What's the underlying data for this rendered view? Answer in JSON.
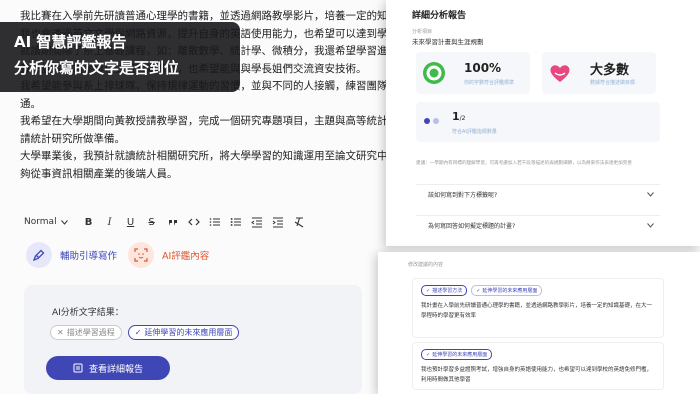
{
  "overlay": {
    "line1": "AI 智慧評鑑報告",
    "line2": "分析你寫的文字是否到位"
  },
  "doc": {
    "lines": [
      "我比賽在入學前先研讀普通心理學的書籍，並透過網路教學影片，培養一定的知識基礎",
      "我也會透過英文文學與網路資源，提升自身的英語使用能力，也希望可以達到學校的英語免修門檻",
      "就讀期間除了系上基礎課程，如：離散數學、統計學、微積分，我還希望學習進階演",
      "算法課程，為參與程式競賽做準備，也希望能與與學長姐們交流資安技術。",
      "我希望能參與系上排球隊，保持規律運動的習慣，並與不同的人接觸，練習團隊合作與溝",
      "通。",
      "我希望在大學期間向黃教授請教學習，完成一個研究專題項目，主題與高等統計相關，並",
      "請統計研究所做準備。",
      "大學畢業後，我預計就讀統計相關研究所，將大學學習的知識運用至論文研究中，讓我能",
      "夠從事資訊相關產業的後端人員。"
    ]
  },
  "toolbar": {
    "style_label": "Normal",
    "bold": "B",
    "italic": "I",
    "underline": "U",
    "strike": "S"
  },
  "actions": {
    "assist_label": "輔助引導寫作",
    "ai_label": "AI評鑑內容"
  },
  "result": {
    "label": "AI分析文字結果：",
    "tag_off": "描述學習過程",
    "tag_on": "延伸學習的未來應用層面",
    "view_button": "查看詳細報告"
  },
  "report": {
    "header": "詳細分析報告",
    "section_label": "分析項目",
    "section_title": "未來學習計畫與生涯規劃",
    "stat1_value": "100%",
    "stat1_caption": "你的字數符合評鑑標準",
    "stat2_value": "大多數",
    "stat2_caption": "數據符合描述做目標",
    "stat3_value": "1",
    "stat3_total": "/2",
    "stat3_caption": "符合AI評鑑指標數量",
    "hint": "建議：一學期內有目標的理解學習，可再考慮加入若干段落描述的與規劃細節，以為將來作法表達更加完善",
    "acc1": "該如何寫到對下方標籤呢?",
    "acc2": "為何寫回答如何擬定標題的計畫?"
  },
  "suggestions": {
    "label": "修改建議的內容",
    "item1_chip1": "描述學習方法",
    "item1_chip2": "延伸學習的未來應用層面",
    "item1_text": "我計畫在入學前先研讀普通心理學的書籍，並透過網路教學影片，培養一定的知識基礎，在大一學程時的學習更有效率",
    "item2_chip1": "延伸學習的未來應用層面",
    "item2_text": "我也預計學習多益證照考試，增強自身的英語使用能力，也希望可以達到學校的英語免修門檻，利用時間做其他學習"
  },
  "colors": {
    "accent": "#3f47b7",
    "orange": "#e0562f",
    "green": "#3fba4b",
    "pink": "#e8487f"
  }
}
